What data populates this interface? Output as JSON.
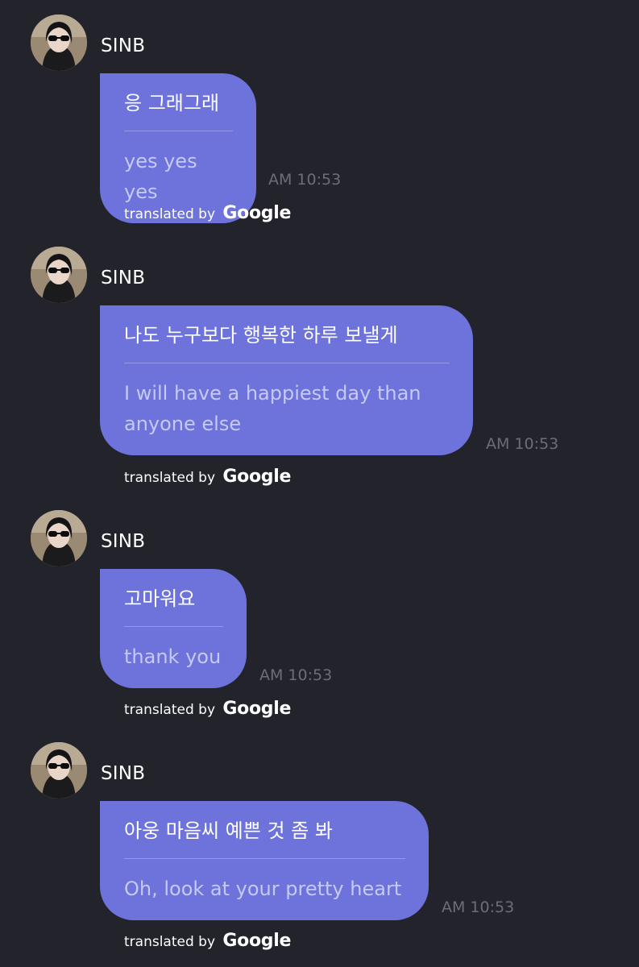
{
  "chat": {
    "messages": [
      {
        "sender": "SINB",
        "original": "응 그래그래",
        "translation": "yes yes yes",
        "time": "AM 10:53",
        "credit_prefix": "translated by",
        "credit_brand": "Google"
      },
      {
        "sender": "SINB",
        "original": "나도 누구보다 행복한 하루 보낼게",
        "translation": "I will have a happiest day than anyone else",
        "time": "AM 10:53",
        "credit_prefix": "translated by",
        "credit_brand": "Google"
      },
      {
        "sender": "SINB",
        "original": "고마워요",
        "translation": "thank you",
        "time": "AM 10:53",
        "credit_prefix": "translated by",
        "credit_brand": "Google"
      },
      {
        "sender": "SINB",
        "original": "아웅 마음씨 예쁜 것 좀 봐",
        "translation": "Oh, look at your pretty heart",
        "time": "AM 10:53",
        "credit_prefix": "translated by",
        "credit_brand": "Google"
      }
    ]
  },
  "colors": {
    "background": "#23242b",
    "bubble": "#6e73db",
    "translation_text": "#c6c9f3",
    "timestamp": "#6b6d78"
  },
  "icons": {
    "avatar": "profile-photo"
  }
}
